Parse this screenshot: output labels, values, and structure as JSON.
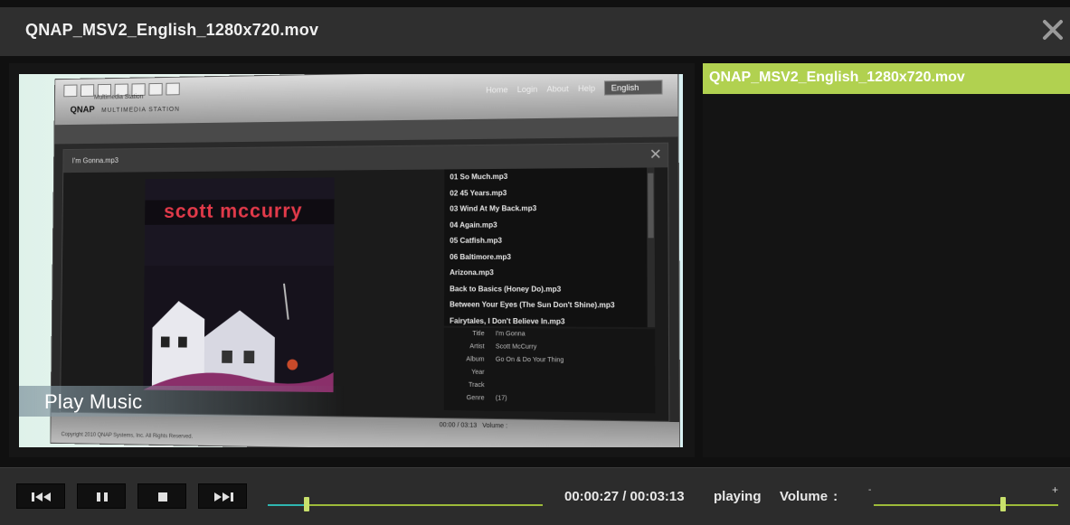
{
  "window": {
    "title": "QNAP_MSV2_English_1280x720.mov"
  },
  "video": {
    "overlay_caption": "Play Music",
    "frame": {
      "brand": "QNAP",
      "brand_sub": "MULTIMEDIA STATION",
      "app_name": "Multimedia Station",
      "nav": [
        "Home",
        "Login",
        "About",
        "Help"
      ],
      "language": "English",
      "now_playing_file": "I'm Gonna.mp3",
      "album_artist_text": "scott mccurry",
      "tracks": [
        "01 So Much.mp3",
        "02 45 Years.mp3",
        "03 Wind At My Back.mp3",
        "04 Again.mp3",
        "05 Catfish.mp3",
        "06 Baltimore.mp3",
        "Arizona.mp3",
        "Back to Basics (Honey Do).mp3",
        "Between Your Eyes (The Sun Don't Shine).mp3",
        "Fairytales, I Don't Believe In.mp3"
      ],
      "meta": [
        {
          "k": "Title",
          "v": "I'm Gonna"
        },
        {
          "k": "Artist",
          "v": "Scott McCurry"
        },
        {
          "k": "Album",
          "v": "Go On & Do Your Thing"
        },
        {
          "k": "Year",
          "v": ""
        },
        {
          "k": "Track",
          "v": ""
        },
        {
          "k": "Genre",
          "v": "(17)"
        }
      ],
      "time": "00:00 / 03:13",
      "volume_label": "Volume :",
      "copyright": "Copyright 2010 QNAP Systems, Inc. All Rights Reserved."
    }
  },
  "playlist": {
    "items": [
      "QNAP_MSV2_English_1280x720.mov"
    ]
  },
  "controls": {
    "time": "00:00:27 / 00:03:13",
    "status": "playing",
    "volume_label": "Volume",
    "volume_colon": ":",
    "volume_minus": "-",
    "volume_plus": "+",
    "progress_fraction": 0.14,
    "volume_fraction": 0.7
  },
  "colors": {
    "accent": "#b1d150",
    "seek_played": "#2fb6b0",
    "background": "#101010"
  }
}
